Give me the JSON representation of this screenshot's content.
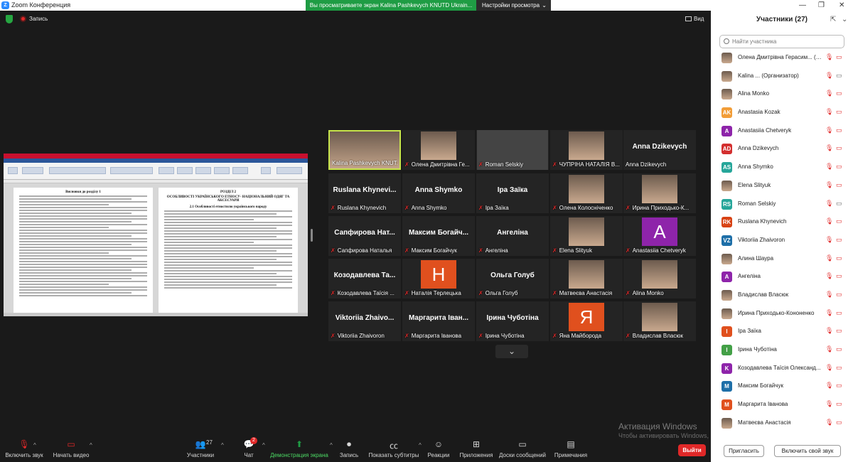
{
  "window": {
    "title": "Zoom Конференция",
    "share_banner": "Вы просматриваете экран Kalina Pashkevych KNUTD Ukrain...",
    "view_options": "Настройки просмотра",
    "record_label": "Запись",
    "view_label": "Вид"
  },
  "shared_doc": {
    "left_heading": "Висновки до розділу 1",
    "right_heading": "РОЗДІЛ 2",
    "right_subheading": "ОСОБЛИВОСТІ УКРАЇНСЬКОГО ЕТНОСУ- НАЦІОНАЛЬНИЙ ОДЯГ ТА АКСЕСУАРИ",
    "right_section": "2.1 Особливості етностилю українського народу"
  },
  "gallery": [
    {
      "caption": "Kalina Pashkevych KNUT...",
      "big": "",
      "kind": "photo",
      "muted": false
    },
    {
      "caption": "Олена Дмитрівна Ге...",
      "big": "",
      "kind": "photo",
      "muted": true
    },
    {
      "caption": "Roman Selskiy",
      "big": "",
      "kind": "dark",
      "muted": true
    },
    {
      "caption": "ЧУПРІНА НАТАЛІЯ В...",
      "big": "",
      "kind": "photo",
      "muted": true
    },
    {
      "caption": "Anna Dzikevych",
      "big": "Anna Dzikevych",
      "kind": "name",
      "muted": false
    },
    {
      "caption": "Ruslana Khynevich",
      "big": "Ruslana Khynevi...",
      "kind": "name",
      "muted": true
    },
    {
      "caption": "Anna Shymko",
      "big": "Anna Shymko",
      "kind": "name",
      "muted": true
    },
    {
      "caption": "Іра Заїка",
      "big": "Іра Заїка",
      "kind": "name",
      "muted": true
    },
    {
      "caption": "Олена Колосніченко",
      "big": "",
      "kind": "photo",
      "muted": true
    },
    {
      "caption": "Ирина Приходько-К...",
      "big": "",
      "kind": "photo",
      "muted": true
    },
    {
      "caption": "Сапфирова Наталья",
      "big": "Сапфирова Нат...",
      "kind": "name",
      "muted": true
    },
    {
      "caption": "Максим Богайчук",
      "big": "Максим Богайч...",
      "kind": "name",
      "muted": true
    },
    {
      "caption": "Ангеліна",
      "big": "Ангеліна",
      "kind": "name",
      "muted": true
    },
    {
      "caption": "Elena Slityuk",
      "big": "",
      "kind": "photo",
      "muted": true
    },
    {
      "caption": "Anastasiia Chetveryk",
      "big": "",
      "kind": "avatar",
      "letter": "A",
      "color": "#8e24aa",
      "muted": true
    },
    {
      "caption": "Козодавлева Таїсія ...",
      "big": "Козодавлева Та...",
      "kind": "name",
      "muted": true
    },
    {
      "caption": "Наталія Терлецька",
      "big": "",
      "kind": "avatar",
      "letter": "H",
      "color": "#e0501e",
      "muted": true
    },
    {
      "caption": "Ольга Голуб",
      "big": "Ольга Голуб",
      "kind": "name",
      "muted": true
    },
    {
      "caption": "Матвеєва Анастасія",
      "big": "",
      "kind": "photo",
      "muted": true
    },
    {
      "caption": "Alina Monko",
      "big": "",
      "kind": "photo",
      "muted": true
    },
    {
      "caption": "Viktoriia Zhaivoron",
      "big": "Viktoriia Zhaivo...",
      "kind": "name",
      "muted": true
    },
    {
      "caption": "Маргарита Іванова",
      "big": "Маргарита Іван...",
      "kind": "name",
      "muted": true
    },
    {
      "caption": "Ірина Чуботіна",
      "big": "Ірина Чуботіна",
      "kind": "name",
      "muted": true
    },
    {
      "caption": "Яна Майборода",
      "big": "",
      "kind": "avatar",
      "letter": "Я",
      "color": "#e0501e",
      "muted": true
    },
    {
      "caption": "Владислав Власюк",
      "big": "",
      "kind": "photo",
      "muted": true
    }
  ],
  "panel": {
    "title": "Участники (27)",
    "search_placeholder": "Найти участника",
    "participants": [
      {
        "name": "Олена Дмитрівна Герасим...  (Я)",
        "av": "",
        "color": "",
        "img": true,
        "cam": false
      },
      {
        "name": "Kalina ...  (Организатор)",
        "av": "",
        "color": "",
        "img": true,
        "cam": true
      },
      {
        "name": "Alina Monko",
        "av": "",
        "color": "",
        "img": true,
        "cam": false
      },
      {
        "name": "Anastasia Kozak",
        "av": "AK",
        "color": "#f29d38",
        "img": false,
        "cam": false
      },
      {
        "name": "Anastasiia Chetveryk",
        "av": "A",
        "color": "#8e24aa",
        "img": false,
        "cam": false
      },
      {
        "name": "Anna Dzikevych",
        "av": "AD",
        "color": "#d32f2f",
        "img": false,
        "cam": false
      },
      {
        "name": "Anna Shymko",
        "av": "AS",
        "color": "#26a69a",
        "img": false,
        "cam": false
      },
      {
        "name": "Elena Slityuk",
        "av": "",
        "color": "",
        "img": true,
        "cam": false
      },
      {
        "name": "Roman Selskiy",
        "av": "RS",
        "color": "#26a69a",
        "img": false,
        "cam": true
      },
      {
        "name": "Ruslana Khynevich",
        "av": "RK",
        "color": "#d84315",
        "img": false,
        "cam": false
      },
      {
        "name": "Viktoriia Zhaivoron",
        "av": "VZ",
        "color": "#1e6fa8",
        "img": false,
        "cam": false
      },
      {
        "name": "Алина Шаура",
        "av": "",
        "color": "",
        "img": true,
        "cam": false
      },
      {
        "name": "Ангеліна",
        "av": "A",
        "color": "#8e24aa",
        "img": false,
        "cam": false
      },
      {
        "name": "Владислав Власюк",
        "av": "",
        "color": "",
        "img": true,
        "cam": false
      },
      {
        "name": "Ирина Приходько-Кононенко",
        "av": "",
        "color": "",
        "img": true,
        "cam": false
      },
      {
        "name": "Іра Заїка",
        "av": "І",
        "color": "#e0501e",
        "img": false,
        "cam": false
      },
      {
        "name": "Ірина Чуботіна",
        "av": "І",
        "color": "#43a047",
        "img": false,
        "cam": false
      },
      {
        "name": "Козодавлева Таїсія Олександ...",
        "av": "K",
        "color": "#8e24aa",
        "img": false,
        "cam": false
      },
      {
        "name": "Максим Богайчук",
        "av": "M",
        "color": "#1e6fa8",
        "img": false,
        "cam": false
      },
      {
        "name": "Маргарита Іванова",
        "av": "M",
        "color": "#e0501e",
        "img": false,
        "cam": false
      },
      {
        "name": "Матвеєва Анастасія",
        "av": "",
        "color": "",
        "img": true,
        "cam": false
      }
    ],
    "invite": "Пригласить",
    "unmute_all": "Включить свой звук"
  },
  "watermark": {
    "line1": "Активация Windows",
    "line2": "Чтобы активировать Windows, перейдите в раздел \"Параметры\"."
  },
  "toolbar": {
    "unmute": "Включить звук",
    "start_video": "Начать видео",
    "participants": "Участники",
    "participants_count": "27",
    "chat": "Чат",
    "chat_badge": "2",
    "share": "Демонстрация экрана",
    "record": "Запись",
    "captions": "Показать субтитры",
    "reactions": "Реакции",
    "apps": "Приложения",
    "whiteboards": "Доски сообщений",
    "notes": "Примечания",
    "leave": "Выйти"
  },
  "colors": {
    "accent": "#2d8cff",
    "share_green": "#1f9c44",
    "leave_red": "#e02828",
    "active_speaker": "#c7e54b"
  }
}
